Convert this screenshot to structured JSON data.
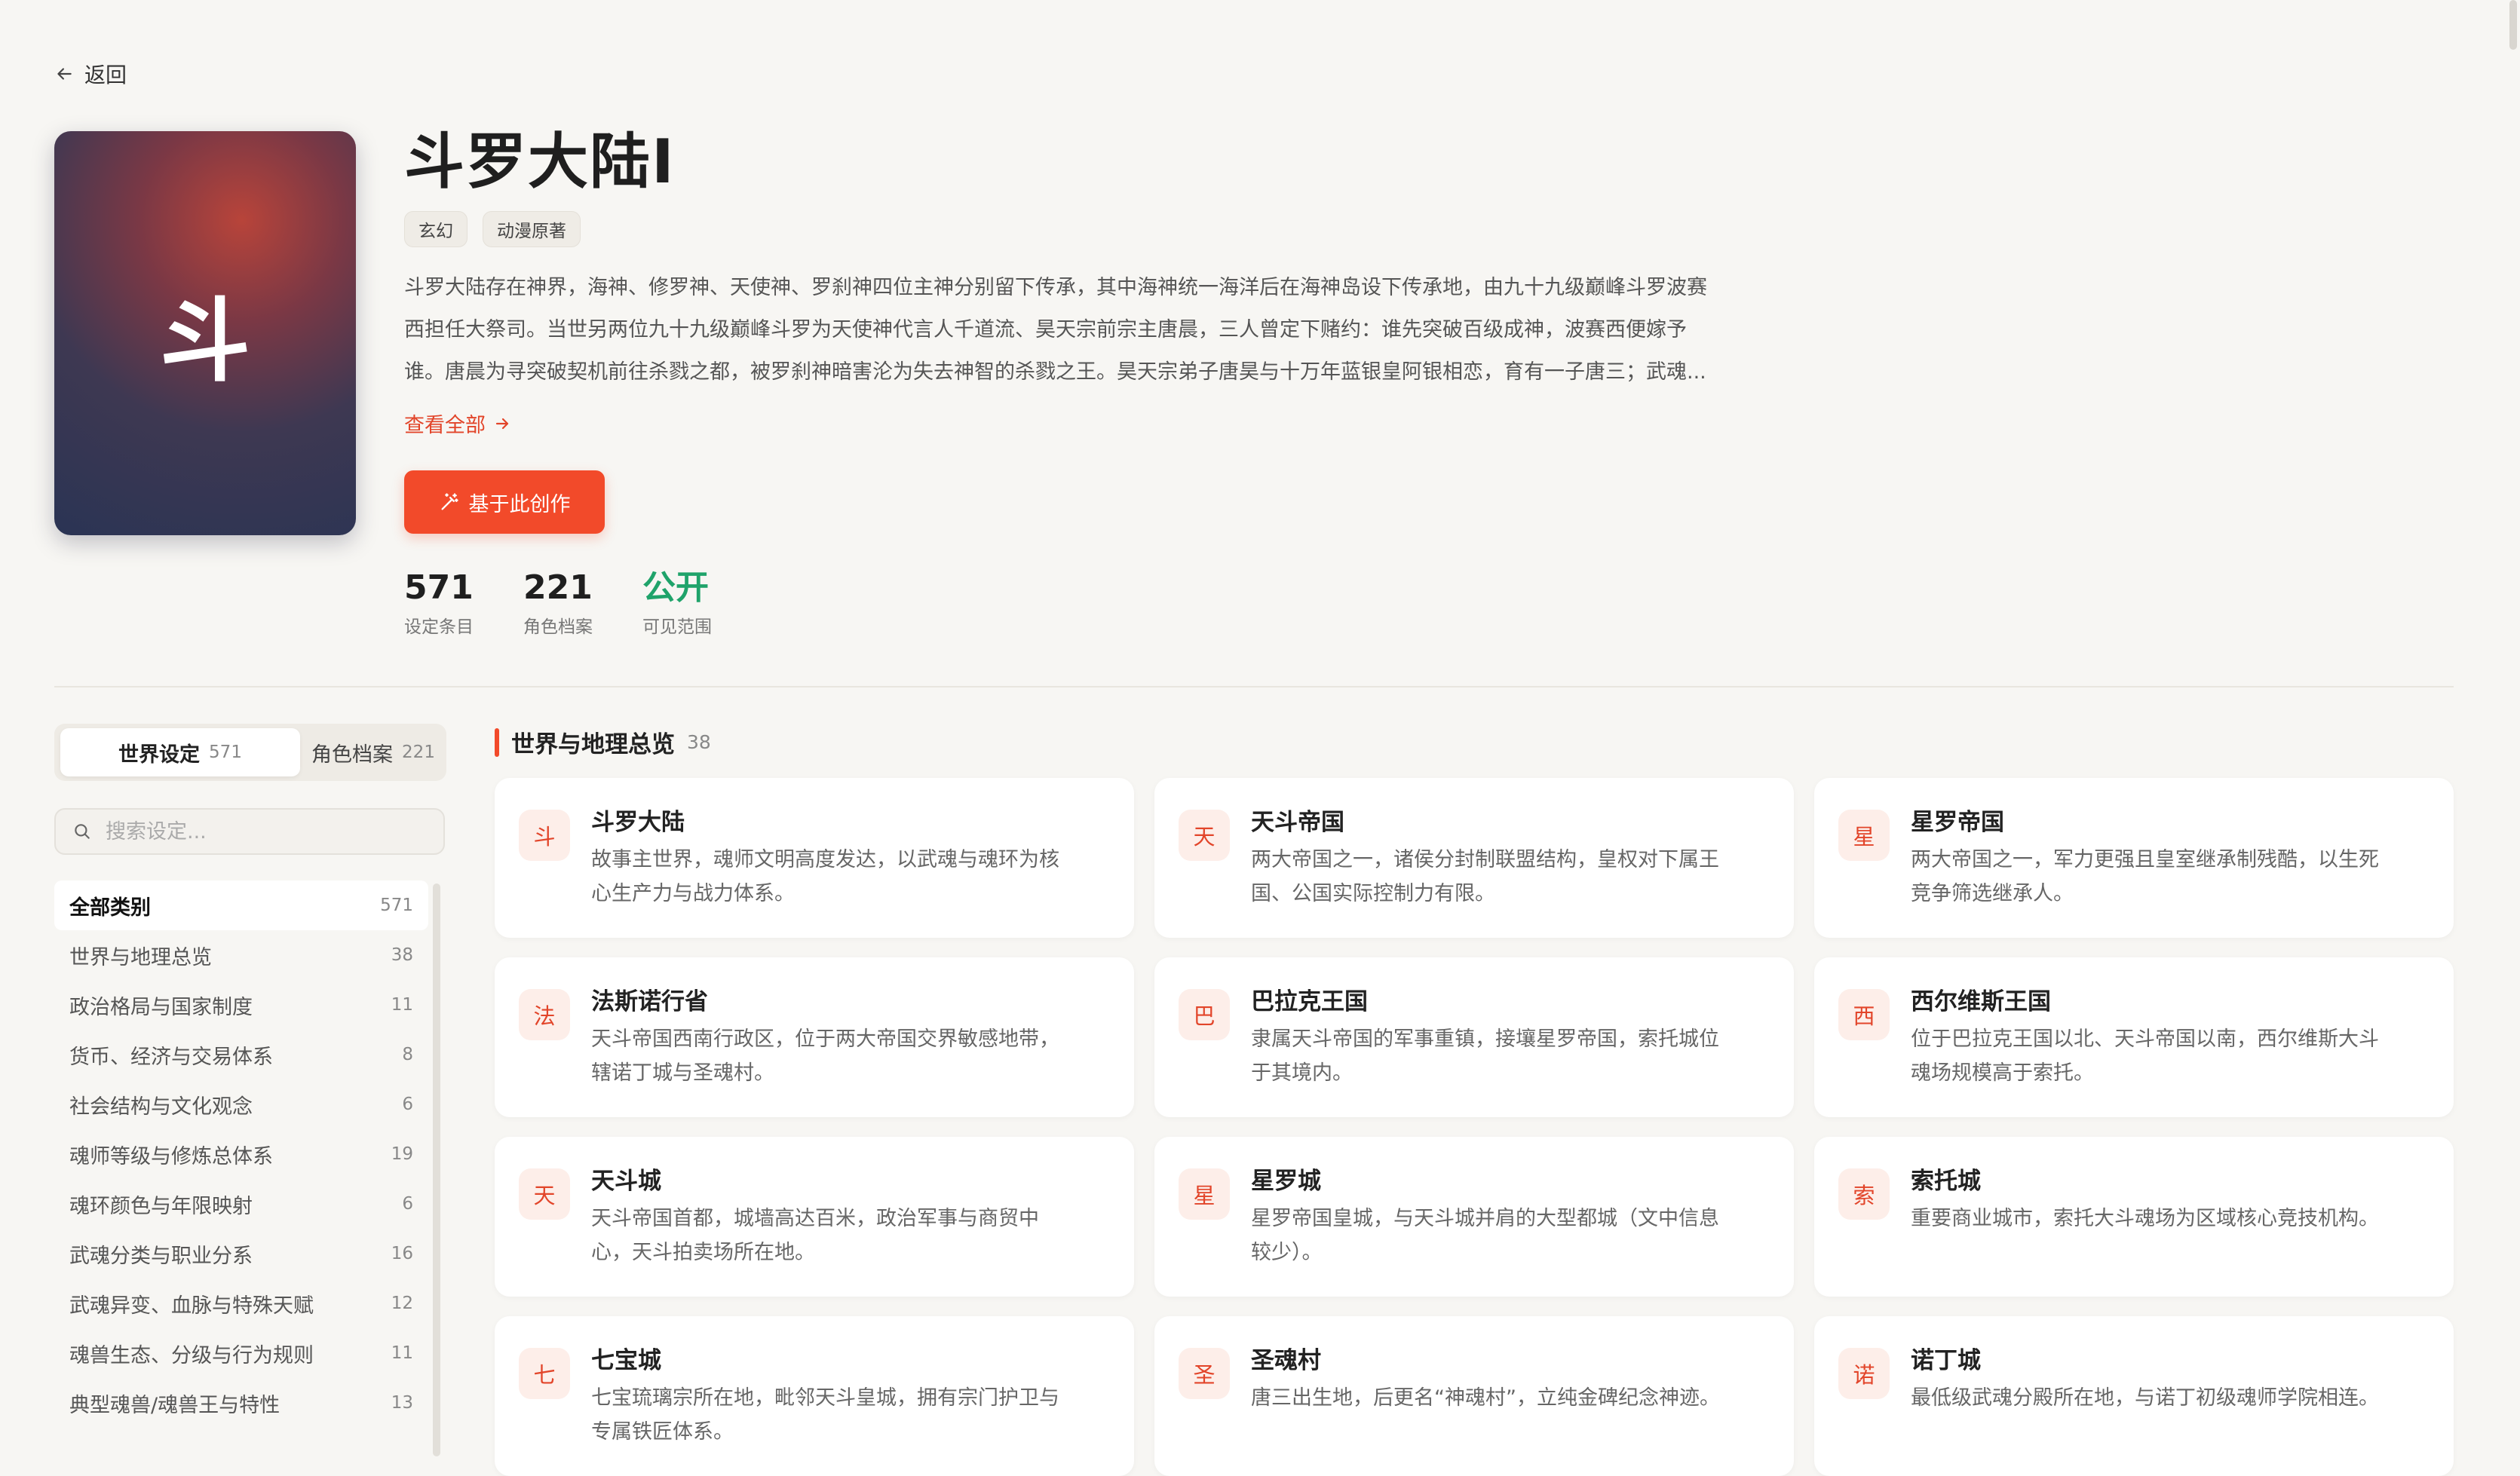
{
  "nav": {
    "back_label": "返回"
  },
  "work": {
    "cover_char": "斗",
    "title": "斗罗大陆I",
    "tags": [
      "玄幻",
      "动漫原著"
    ],
    "description_lines": [
      "斗罗大陆存在神界，海神、修罗神、天使神、罗刹神四位主神分别留下传承，其中海神统一海洋后在海神岛设下传承地，由九十九级巅峰斗罗波赛",
      "西担任大祭司。当世另两位九十九级巅峰斗罗为天使神代言人千道流、昊天宗前宗主唐晨，三人曾定下赌约：谁先突破百级成神，波赛西便嫁予",
      "谁。唐晨为寻突破契机前往杀戮之都，被罗刹神暗害沦为失去神智的杀戮之王。昊天宗弟子唐昊与十万年蓝银皇阿银相恋，育有一子唐三；武魂..."
    ],
    "view_all_label": "查看全部",
    "create_button_label": "基于此创作",
    "stats": [
      {
        "value": "571",
        "label": "设定条目"
      },
      {
        "value": "221",
        "label": "角色档案"
      },
      {
        "value": "公开",
        "label": "可见范围"
      }
    ]
  },
  "sidebar": {
    "tabs": [
      {
        "label": "世界设定",
        "count": "571"
      },
      {
        "label": "角色档案",
        "count": "221"
      }
    ],
    "search_placeholder": "搜索设定...",
    "categories": [
      {
        "label": "全部类别",
        "count": "571"
      },
      {
        "label": "世界与地理总览",
        "count": "38"
      },
      {
        "label": "政治格局与国家制度",
        "count": "11"
      },
      {
        "label": "货币、经济与交易体系",
        "count": "8"
      },
      {
        "label": "社会结构与文化观念",
        "count": "6"
      },
      {
        "label": "魂师等级与修炼总体系",
        "count": "19"
      },
      {
        "label": "魂环颜色与年限映射",
        "count": "6"
      },
      {
        "label": "武魂分类与职业分系",
        "count": "16"
      },
      {
        "label": "武魂异变、血脉与特殊天赋",
        "count": "12"
      },
      {
        "label": "魂兽生态、分级与行为规则",
        "count": "11"
      },
      {
        "label": "典型魂兽/魂兽王与特性",
        "count": "13"
      }
    ]
  },
  "section": {
    "title": "世界与地理总览",
    "count": "38",
    "cards": [
      {
        "icon": "斗",
        "title": "斗罗大陆",
        "desc": "故事主世界，魂师文明高度发达，以武魂与魂环为核心生产力与战力体系。"
      },
      {
        "icon": "天",
        "title": "天斗帝国",
        "desc": "两大帝国之一，诸侯分封制联盟结构，皇权对下属王国、公国实际控制力有限。"
      },
      {
        "icon": "星",
        "title": "星罗帝国",
        "desc": "两大帝国之一，军力更强且皇室继承制残酷，以生死竞争筛选继承人。"
      },
      {
        "icon": "法",
        "title": "法斯诺行省",
        "desc": "天斗帝国西南行政区，位于两大帝国交界敏感地带，辖诺丁城与圣魂村。"
      },
      {
        "icon": "巴",
        "title": "巴拉克王国",
        "desc": "隶属天斗帝国的军事重镇，接壤星罗帝国，索托城位于其境内。"
      },
      {
        "icon": "西",
        "title": "西尔维斯王国",
        "desc": "位于巴拉克王国以北、天斗帝国以南，西尔维斯大斗魂场规模高于索托。"
      },
      {
        "icon": "天",
        "title": "天斗城",
        "desc": "天斗帝国首都，城墙高达百米，政治军事与商贸中心，天斗拍卖场所在地。"
      },
      {
        "icon": "星",
        "title": "星罗城",
        "desc": "星罗帝国皇城，与天斗城并肩的大型都城（文中信息较少）。"
      },
      {
        "icon": "索",
        "title": "索托城",
        "desc": "重要商业城市，索托大斗魂场为区域核心竞技机构。"
      },
      {
        "icon": "七",
        "title": "七宝城",
        "desc": "七宝琉璃宗所在地，毗邻天斗皇城，拥有宗门护卫与专属铁匠体系。"
      },
      {
        "icon": "圣",
        "title": "圣魂村",
        "desc": "唐三出生地，后更名“神魂村”，立纯金碑纪念神迹。"
      },
      {
        "icon": "诺",
        "title": "诺丁城",
        "desc": "最低级武魂分殿所在地，与诺丁初级魂师学院相连。"
      }
    ]
  },
  "colors": {
    "accent": "#f24a2a",
    "green": "#1fa36a",
    "background": "#f7f6f3"
  }
}
